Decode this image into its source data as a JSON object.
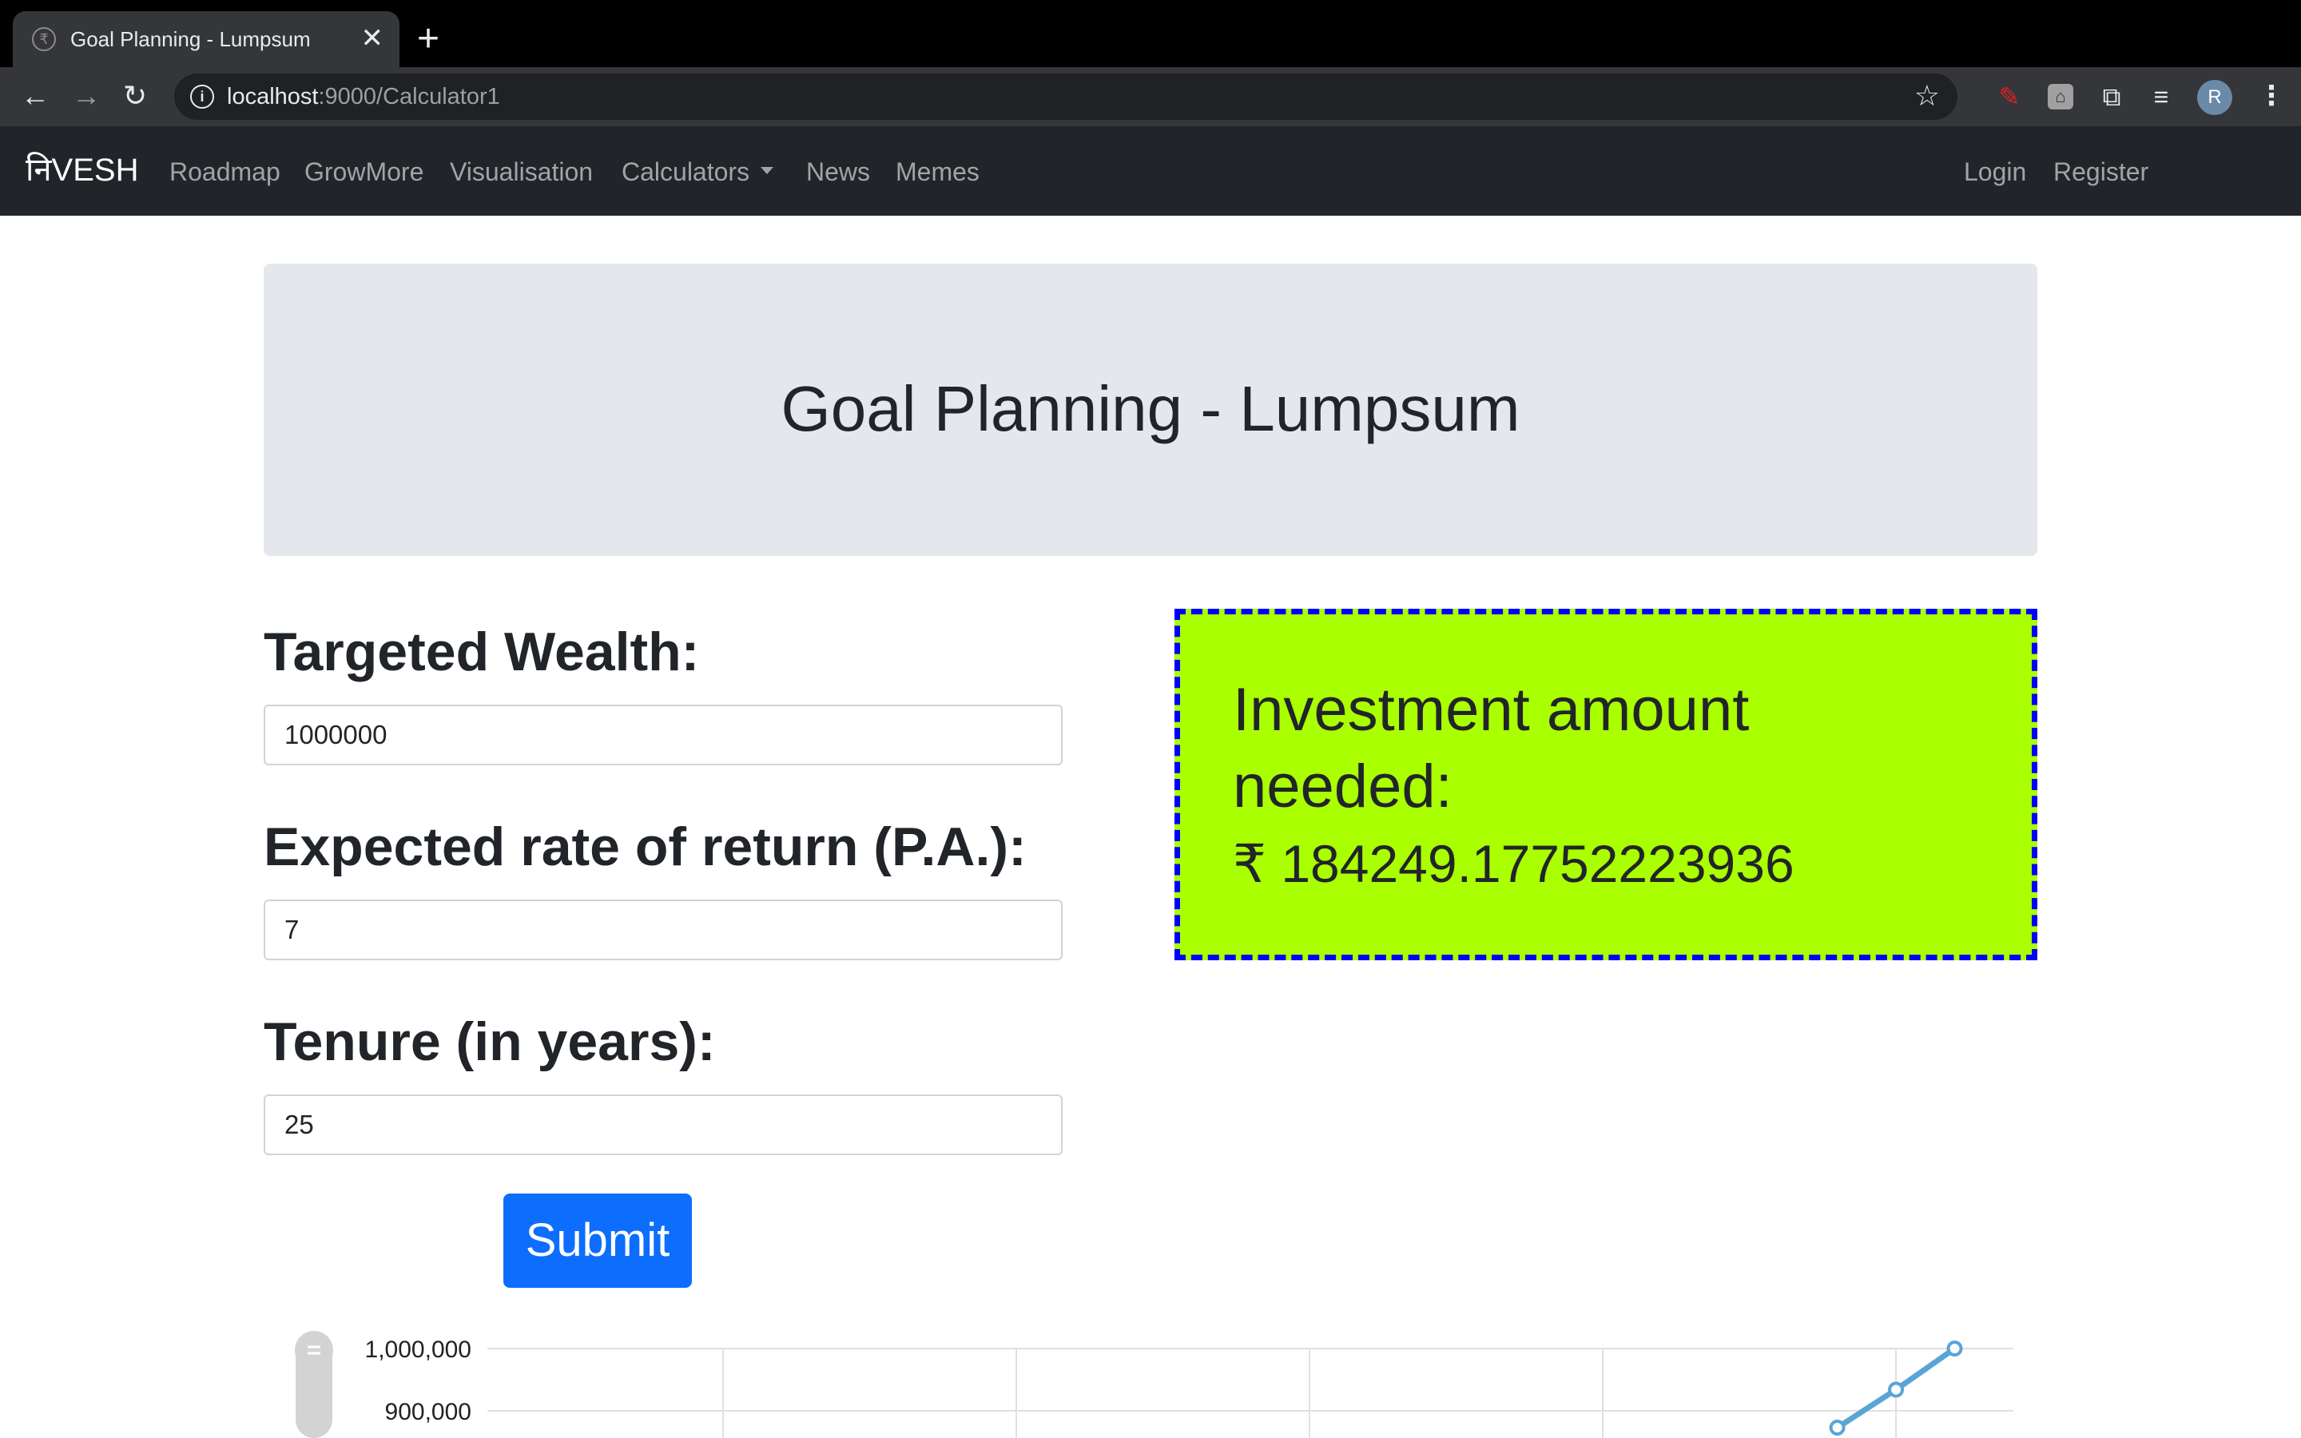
{
  "browser": {
    "tab_title": "Goal Planning - Lumpsum",
    "tab_close": "✕",
    "new_tab": "+",
    "url_host": "localhost",
    "url_path": ":9000/Calculator1",
    "avatar_initial": "R",
    "icons": [
      "back-icon",
      "forward-icon",
      "reload-icon",
      "info-icon",
      "star-icon",
      "pen-extension-icon",
      "box-extension-icon",
      "puzzle-icon",
      "reading-list-icon",
      "kebab-menu-icon"
    ]
  },
  "navbar": {
    "brand": "निVESH",
    "links": [
      "Roadmap",
      "GrowMore",
      "Visualisation",
      "Calculators",
      "News",
      "Memes"
    ],
    "right_links": [
      "Login",
      "Register"
    ]
  },
  "main": {
    "title": "Goal Planning - Lumpsum",
    "targeted_wealth_label": "Targeted Wealth:",
    "targeted_wealth_value": "1000000",
    "rate_label": "Expected rate of return (P.A.):",
    "rate_value": "7",
    "tenure_label": "Tenure (in years):",
    "tenure_value": "25",
    "submit_label": "Submit",
    "result_heading": "Investment amount needed:",
    "result_value": "₹ 184249.17752223936"
  },
  "colors": {
    "navbar_bg": "#212529",
    "jumbotron_bg": "#e4e7eb",
    "result_bg": "#aaff00",
    "result_border": "#0000ff",
    "submit_bg": "#0d6efd",
    "series_color": "#5aa5d6"
  },
  "chart_data": {
    "type": "line",
    "y_tick_labels": [
      "1,000,000",
      "900,000"
    ],
    "ylim": [
      900000,
      1000000
    ],
    "x_gridlines": 5,
    "grid": true,
    "series": [
      {
        "values": [
          {
            "x": 23,
            "y": 873000
          },
          {
            "x": 24,
            "y": 934000
          },
          {
            "x": 25,
            "y": 1000000
          }
        ]
      }
    ],
    "xlim": [
      0,
      26
    ]
  }
}
